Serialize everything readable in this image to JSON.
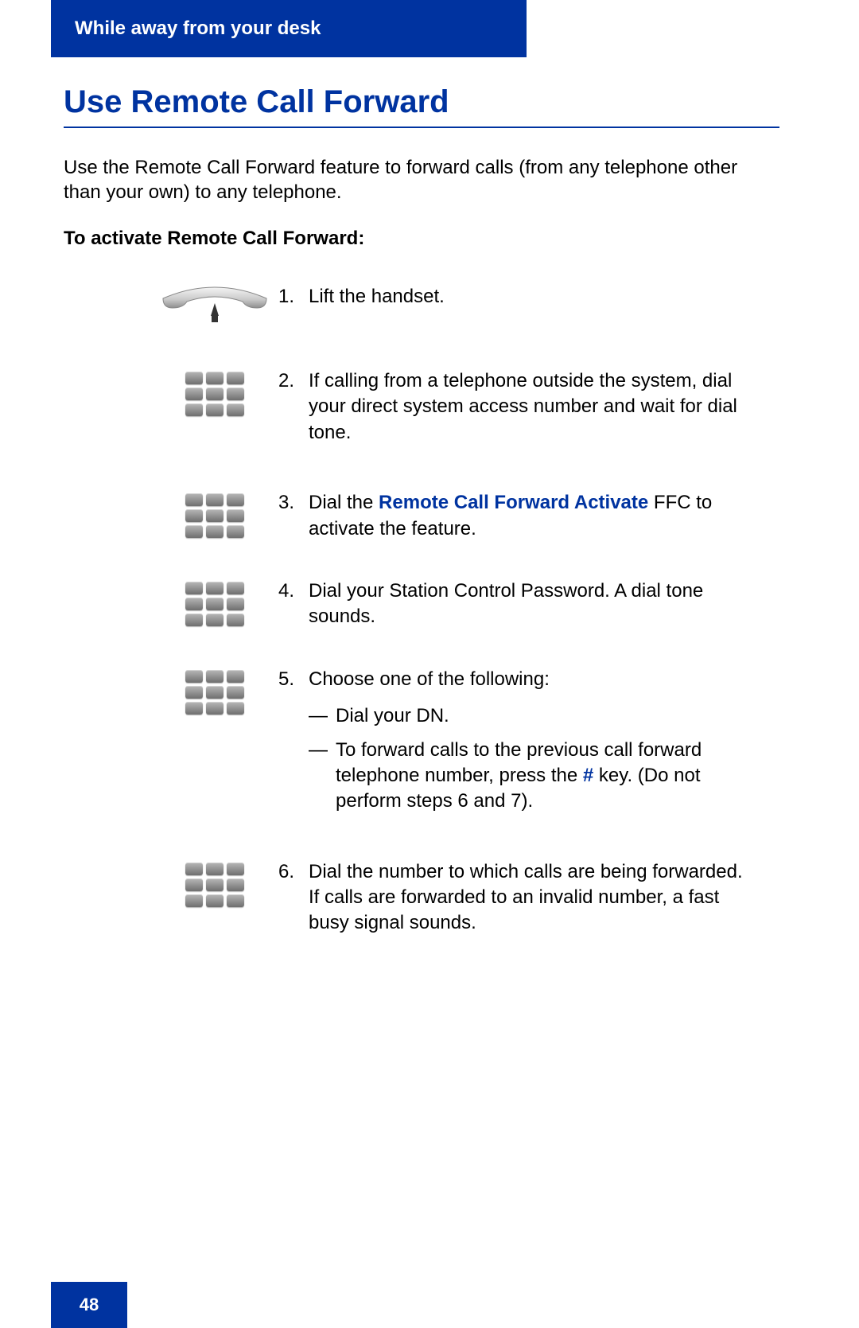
{
  "header": {
    "section_title": "While away from your desk"
  },
  "title": "Use Remote Call Forward",
  "intro": "Use the Remote Call Forward feature to forward calls (from any telephone other than your own) to any telephone.",
  "subhead": "To activate Remote Call Forward:",
  "steps": [
    {
      "num": "1.",
      "icon": "handset",
      "text": "Lift the handset."
    },
    {
      "num": "2.",
      "icon": "keypad",
      "text": "If calling from a telephone outside the system, dial your direct system access number and wait for dial tone."
    },
    {
      "num": "3.",
      "icon": "keypad",
      "pre": "Dial the ",
      "term": "Remote Call Forward Activate",
      "post": " FFC to activate the feature."
    },
    {
      "num": "4.",
      "icon": "keypad",
      "text": "Dial your Station Control Password. A dial tone sounds."
    },
    {
      "num": "5.",
      "icon": "keypad",
      "text": "Choose one of the following:",
      "subitems": [
        {
          "text": "Dial your DN."
        },
        {
          "pre": "To forward calls to the previous call forward telephone number, press the ",
          "term": "#",
          "post": " key. (Do not perform steps 6 and 7)."
        }
      ]
    },
    {
      "num": "6.",
      "icon": "keypad",
      "text": "Dial the number to which calls are being forwarded. If calls are forwarded to an invalid number, a fast busy signal sounds."
    }
  ],
  "page_number": "48"
}
